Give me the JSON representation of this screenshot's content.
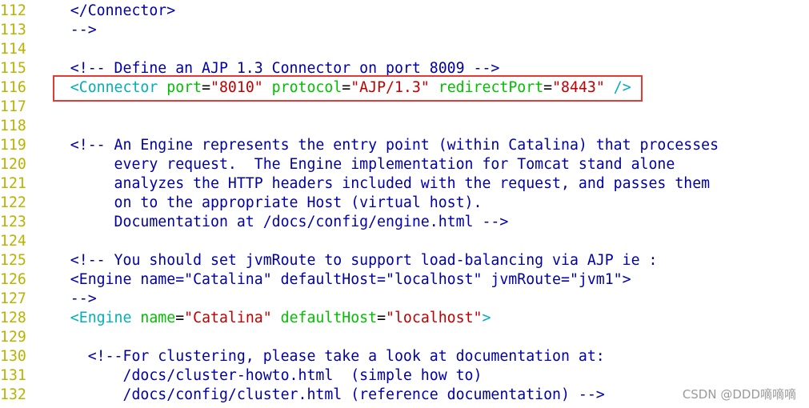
{
  "colors": {
    "line_number": "#b8b400",
    "comment": "#0000a8",
    "tag": "#00b0b8",
    "attribute": "#00c000",
    "string": "#c00000",
    "highlight_box": "#e53935"
  },
  "lines": [
    {
      "n": "112",
      "tokens": [
        [
          "comment",
          "    </Connector>"
        ]
      ]
    },
    {
      "n": "113",
      "tokens": [
        [
          "comment",
          "    -->"
        ]
      ]
    },
    {
      "n": "114",
      "tokens": []
    },
    {
      "n": "115",
      "tokens": [
        [
          "comment",
          "    <!-- Define an AJP 1.3 Connector on port 8009 -->"
        ]
      ]
    },
    {
      "n": "116",
      "tokens": [
        [
          "tag",
          "    <Connector "
        ],
        [
          "attr",
          "port"
        ],
        [
          "plain",
          "="
        ],
        [
          "str",
          "\"8010\""
        ],
        [
          "attr",
          " protocol"
        ],
        [
          "plain",
          "="
        ],
        [
          "str",
          "\"AJP/1.3\""
        ],
        [
          "attr",
          " redirectPort"
        ],
        [
          "plain",
          "="
        ],
        [
          "str",
          "\"8443\""
        ],
        [
          "tag",
          " />"
        ]
      ]
    },
    {
      "n": "117",
      "tokens": []
    },
    {
      "n": "118",
      "tokens": []
    },
    {
      "n": "119",
      "tokens": [
        [
          "comment",
          "    <!-- An Engine represents the entry point (within Catalina) that processes"
        ]
      ]
    },
    {
      "n": "120",
      "tokens": [
        [
          "comment",
          "         every request.  The Engine implementation for Tomcat stand alone"
        ]
      ]
    },
    {
      "n": "121",
      "tokens": [
        [
          "comment",
          "         analyzes the HTTP headers included with the request, and passes them"
        ]
      ]
    },
    {
      "n": "122",
      "tokens": [
        [
          "comment",
          "         on to the appropriate Host (virtual host)."
        ]
      ]
    },
    {
      "n": "123",
      "tokens": [
        [
          "comment",
          "         Documentation at /docs/config/engine.html -->"
        ]
      ]
    },
    {
      "n": "124",
      "tokens": []
    },
    {
      "n": "125",
      "tokens": [
        [
          "comment",
          "    <!-- You should set jvmRoute to support load-balancing via AJP ie :"
        ]
      ]
    },
    {
      "n": "126",
      "tokens": [
        [
          "comment",
          "    <Engine name=\"Catalina\" defaultHost=\"localhost\" jvmRoute=\"jvm1\">"
        ]
      ]
    },
    {
      "n": "127",
      "tokens": [
        [
          "comment",
          "    -->"
        ]
      ]
    },
    {
      "n": "128",
      "tokens": [
        [
          "tag",
          "    <Engine "
        ],
        [
          "attr",
          "name"
        ],
        [
          "plain",
          "="
        ],
        [
          "str",
          "\"Catalina\""
        ],
        [
          "attr",
          " defaultHost"
        ],
        [
          "plain",
          "="
        ],
        [
          "str",
          "\"localhost\""
        ],
        [
          "tag",
          ">"
        ]
      ]
    },
    {
      "n": "129",
      "tokens": []
    },
    {
      "n": "130",
      "tokens": [
        [
          "comment",
          "      <!--For clustering, please take a look at documentation at:"
        ]
      ]
    },
    {
      "n": "131",
      "tokens": [
        [
          "comment",
          "          /docs/cluster-howto.html  (simple how to)"
        ]
      ]
    },
    {
      "n": "132",
      "tokens": [
        [
          "comment",
          "          /docs/config/cluster.html (reference documentation) -->"
        ]
      ]
    }
  ],
  "watermark": "CSDN @DDD嘀嘀嘀"
}
